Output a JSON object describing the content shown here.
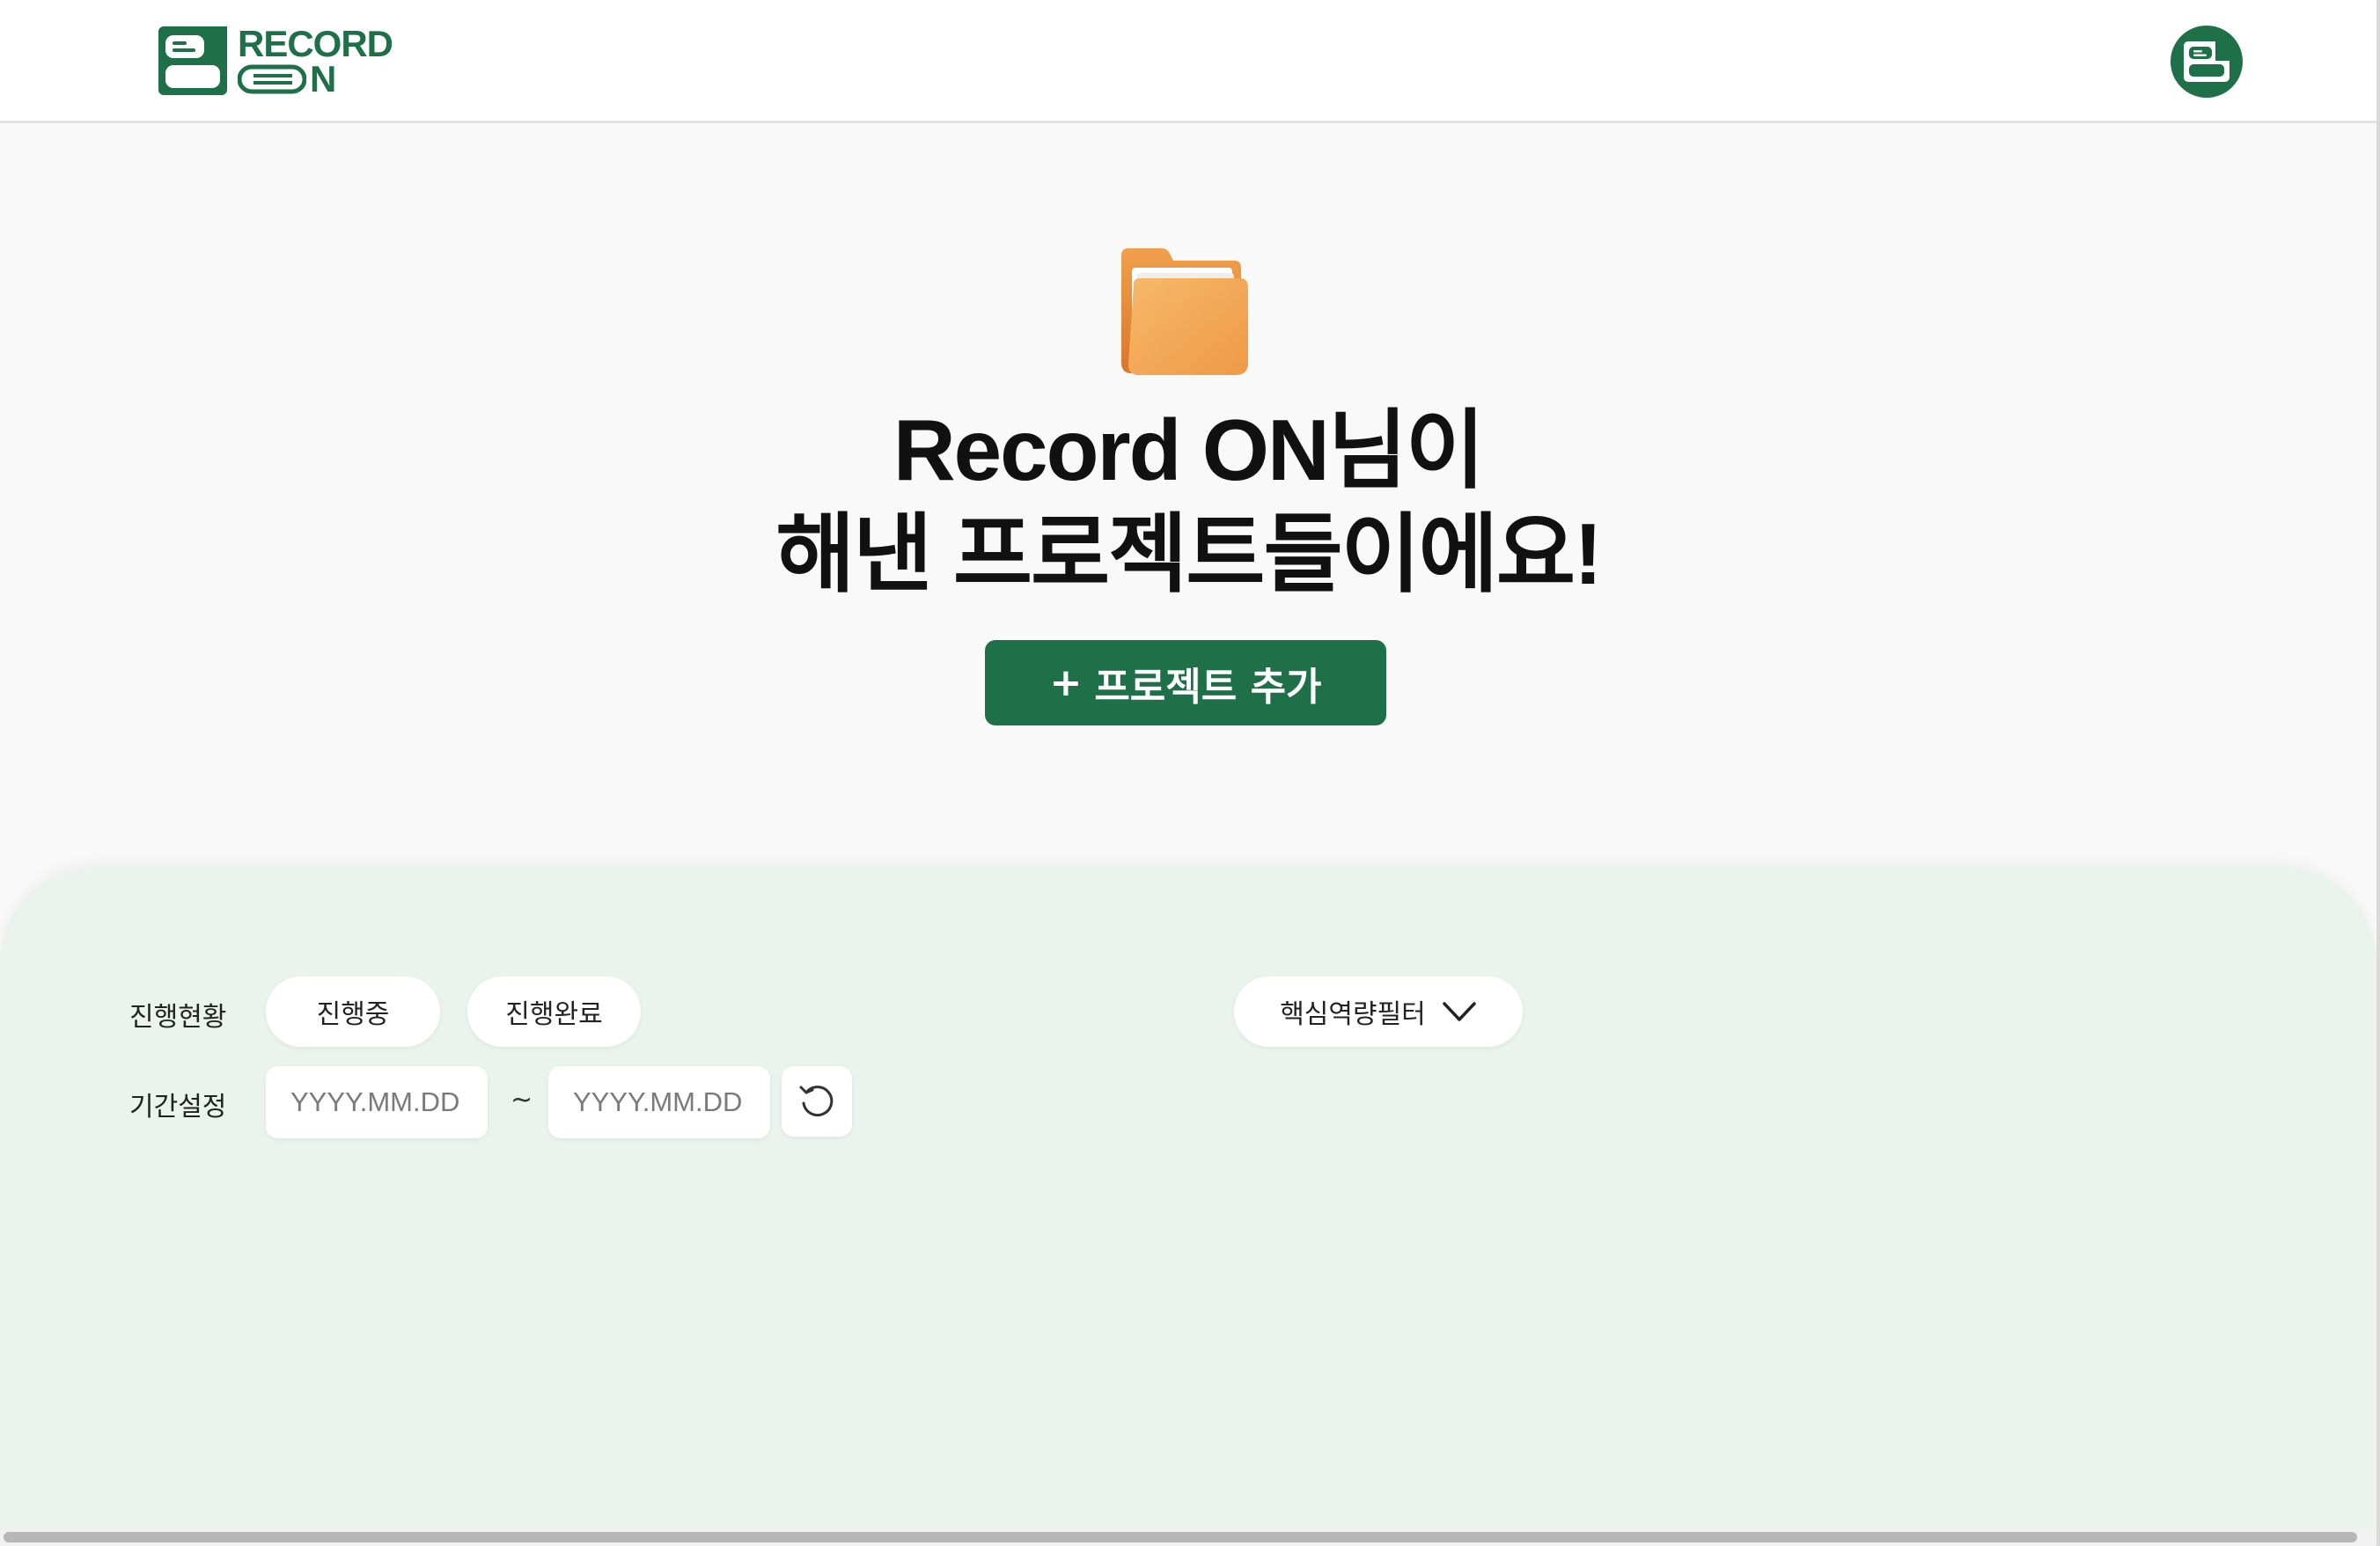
{
  "header": {
    "logo_text_line1": "RECORD",
    "logo_text_line2": "N",
    "brand_color": "#1d7048"
  },
  "hero": {
    "title_line1": "Record ON님이",
    "title_line2": "해낸 프로젝트들이에요!",
    "add_button_plus": "+",
    "add_button_label": "프로젝트 추가"
  },
  "filters": {
    "status_label": "진행현황",
    "status_options": [
      "진행중",
      "진행완료"
    ],
    "competency_filter_label": "핵심역량필터",
    "period_label": "기간설정",
    "start_date_placeholder": "YYYY.MM.DD",
    "end_date_placeholder": "YYYY.MM.DD",
    "range_separator": "~"
  },
  "icons": {
    "logo": "record-on-logo-icon",
    "avatar": "profile-avatar-icon",
    "hero": "folder-icon",
    "dropdown": "chevron-down-icon",
    "reset": "refresh-icon"
  },
  "colors": {
    "primary": "#1d7048",
    "panel_bg": "#eaf3ee",
    "page_bg": "#f9f9f9",
    "folder": "#f3a24a"
  }
}
